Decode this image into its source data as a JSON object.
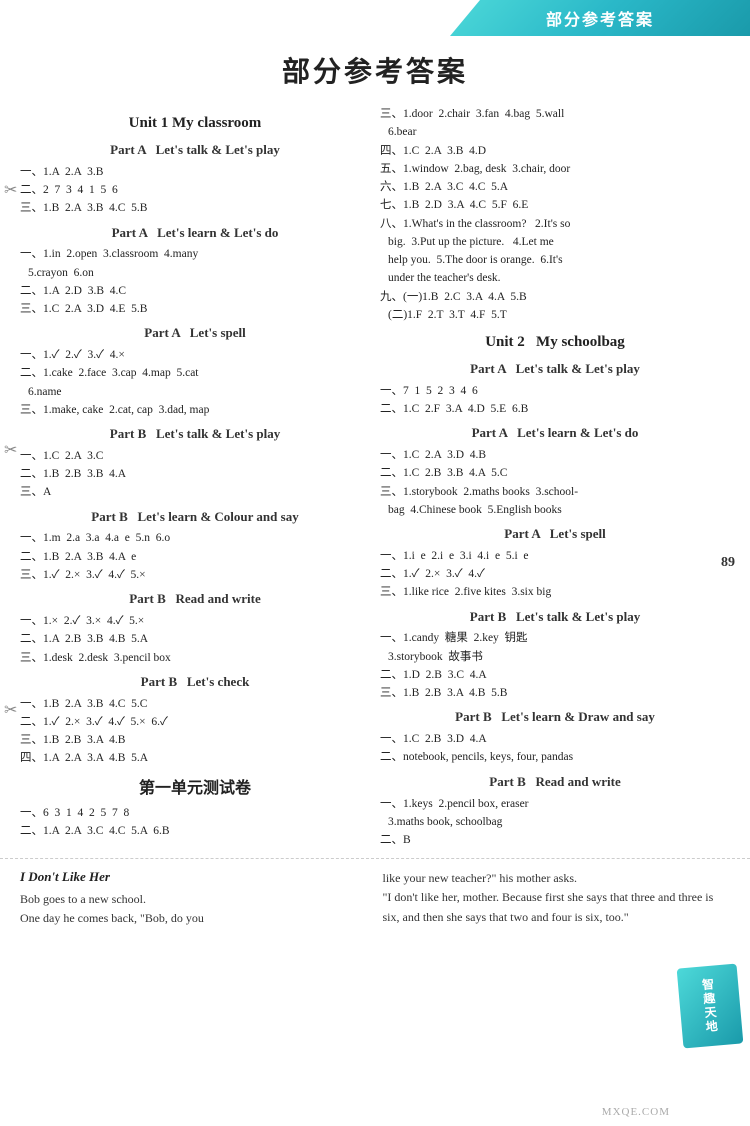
{
  "header": {
    "title": "部分参考答案"
  },
  "main_title": "部分参考答案",
  "page_number": "89",
  "left_column": {
    "unit1_title": "Unit 1   My classroom",
    "sections": [
      {
        "title": "Part A   Let's talk & Let's play",
        "lines": [
          "一、1.A  2.A  3.B",
          "二、2  7  3  4  1  5  6",
          "三、1.B  2.A  3.B  4.C  5.B"
        ]
      },
      {
        "title": "Part A   Let's learn & Let's do",
        "lines": [
          "一、1.in  2.open  3.classroom  4.many",
          "   5.crayon  6.on",
          "二、1.A  2.D  3.B  4.C",
          "三、1.C  2.A  3.D  4.E  5.B"
        ]
      },
      {
        "title": "Part A   Let's spell",
        "lines": [
          "一、1.✓  2.✓  3.✓  4.×",
          "二、1.cake  2.face  3.cap  4.map  5.cat",
          "   6.name",
          "三、1.make, cake  2.cat, cap  3.dad, map"
        ]
      },
      {
        "title": "Part B   Let's talk & Let's play",
        "lines": [
          "一、1.C  2.A  3.C",
          "二、1.B  2.B  3.B  4.A",
          "三、A"
        ]
      },
      {
        "title": "Part B   Let's learn & Colour and say",
        "lines": [
          "一、1.m  2.a  3.a  4.a  e  5.n  6.o",
          "二、1.B  2.A  3.B  4.A  e",
          "三、1.✓  2.×  3.✓  4.✓  5.×"
        ]
      },
      {
        "title": "Part B   Read and write",
        "lines": [
          "一、1.×  2.✓  3.×  4.✓  5.×",
          "二、1.A  2.B  3.B  4.B  5.A",
          "三、1.desk  2.desk  3.pencil box"
        ]
      },
      {
        "title": "Part B   Let's check",
        "lines": [
          "一、1.B  2.A  3.B  4.C  5.C",
          "二、1.✓  2.×  3.✓  4.✓  5.×  6.✓",
          "三、1.B  2.B  3.A  4.B",
          "四、1.A  2.A  3.A  4.B  5.A"
        ]
      },
      {
        "title": "第一单元测试卷",
        "is_chinese": true,
        "lines": [
          "一、6  3  1  4  2  5  7  8",
          "二、1.A  2.A  3.C  4.C  5.A  6.B"
        ]
      }
    ]
  },
  "right_column": {
    "sections": [
      {
        "title": "",
        "lines": [
          "三、1.door  2.chair  3.fan  4.bag  5.wall",
          "   6.bear",
          "四、1.C  2.A  3.B  4.D",
          "五、1.window  2.bag, desk  3.chair, door",
          "六、1.B  2.A  3.C  4.C  5.A",
          "七、1.B  2.D  3.A  4.C  5.F  6.E",
          "八、1.What's in the classroom?  2.It's so",
          "   big.  3.Put up the picture.  4.Let me",
          "   help you.  5.The door is orange.  6.It's",
          "   under the teacher's desk.",
          "九、(一)1.B  2.C  3.A  4.A  5.B",
          "     (二)1.F  2.T  3.T  4.F  5.T"
        ]
      },
      {
        "title": "Unit 2   My schoolbag",
        "is_unit": true,
        "subsections": [
          {
            "title": "Part A   Let's talk & Let's play",
            "lines": [
              "一、7  1  5  2  3  4  6",
              "二、1.C  2.F  3.A  4.D  5.E  6.B"
            ]
          },
          {
            "title": "Part A   Let's learn & Let's do",
            "lines": [
              "一、1.C  2.A  3.D  4.B",
              "二、1.C  2.B  3.B  4.A  5.C",
              "三、1.storybook  2.maths books  3.school-",
              "   bag  4.Chinese book  5.English books"
            ]
          },
          {
            "title": "Part A   Let's spell",
            "lines": [
              "一、1.i  e  2.i  e  3.i  4.i  e  5.i  e",
              "二、1.✓  2.×  3.✓  4.✓",
              "三、1.like rice  2.five kites  3.six big"
            ]
          },
          {
            "title": "Part B   Let's talk & Let's play",
            "lines": [
              "一、1.candy  糖果  2.key  钥匙",
              "   3.storybook  故事书",
              "二、1.D  2.B  3.C  4.A",
              "三、1.B  2.B  3.A  4.B  5.B"
            ]
          },
          {
            "title": "Part B   Let's learn & Draw and say",
            "lines": [
              "一、1.C  2.B  3.D  4.A",
              "二、notebook, pencils, keys, four, pandas"
            ]
          },
          {
            "title": "Part B   Read and write",
            "lines": [
              "一、1.keys  2.pencil box, eraser",
              "   3.maths book, schoolbag",
              "二、B"
            ]
          }
        ]
      }
    ]
  },
  "bottom": {
    "story_title": "I Don't Like Her",
    "story_left": "Bob goes to a new school.\nOne day he comes back, \"Bob, do you",
    "story_right": "like your new teacher?\" his mother asks.\n\"I don't like her, mother. Because first she says that three and three is six, and then she says that two and four is six, too.\""
  },
  "zq_badge": "智趣天地",
  "watermark": "MXQE.COM"
}
